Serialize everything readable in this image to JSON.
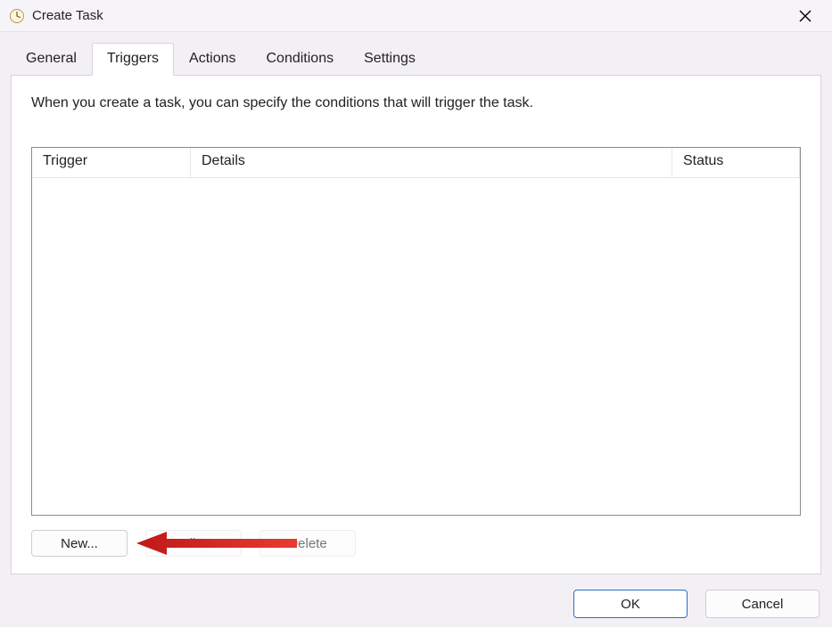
{
  "titlebar": {
    "title": "Create Task"
  },
  "tabs": {
    "general": "General",
    "triggers": "Triggers",
    "actions": "Actions",
    "conditions": "Conditions",
    "settings": "Settings",
    "active": "triggers"
  },
  "triggers_page": {
    "description": "When you create a task, you can specify the conditions that will trigger the task.",
    "columns": {
      "trigger": "Trigger",
      "details": "Details",
      "status": "Status"
    },
    "buttons": {
      "new": "New...",
      "edit": "Edit...",
      "delete": "Delete"
    }
  },
  "footer": {
    "ok": "OK",
    "cancel": "Cancel"
  }
}
